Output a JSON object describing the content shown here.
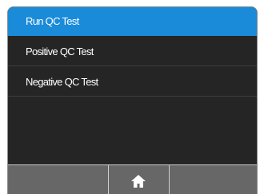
{
  "menu": {
    "items": [
      {
        "label": "Run QC Test",
        "selected": true
      },
      {
        "label": "Positive QC Test",
        "selected": false
      },
      {
        "label": "Negative QC Test",
        "selected": false
      }
    ]
  },
  "bottom_bar": {
    "home_icon": "home-icon"
  },
  "colors": {
    "selected_background": "#1a8bd9",
    "screen_background": "#252525",
    "bottom_bar_background": "#676767"
  }
}
